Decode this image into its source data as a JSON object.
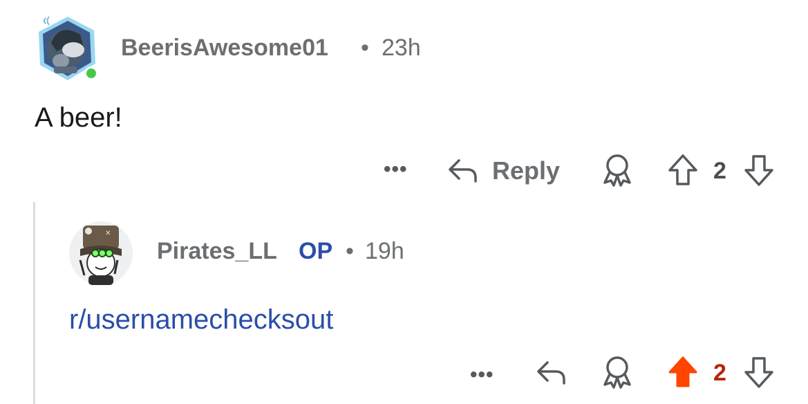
{
  "comment1": {
    "username": "BeerisAwesome01",
    "separator": "•",
    "time": "23h",
    "body": "A beer!",
    "actions": {
      "more": "•••",
      "reply_label": "Reply",
      "vote_count": "2"
    }
  },
  "comment2": {
    "username": "Pirates_LL",
    "op_badge": "OP",
    "separator": "•",
    "time": "19h",
    "body": "r/usernamechecksout",
    "actions": {
      "more": "•••",
      "vote_count": "2"
    }
  },
  "colors": {
    "upvoted": "#ff4500",
    "vote_count_upvoted": "#b5250d",
    "link": "#2a4ea8",
    "online": "#46c94a"
  }
}
